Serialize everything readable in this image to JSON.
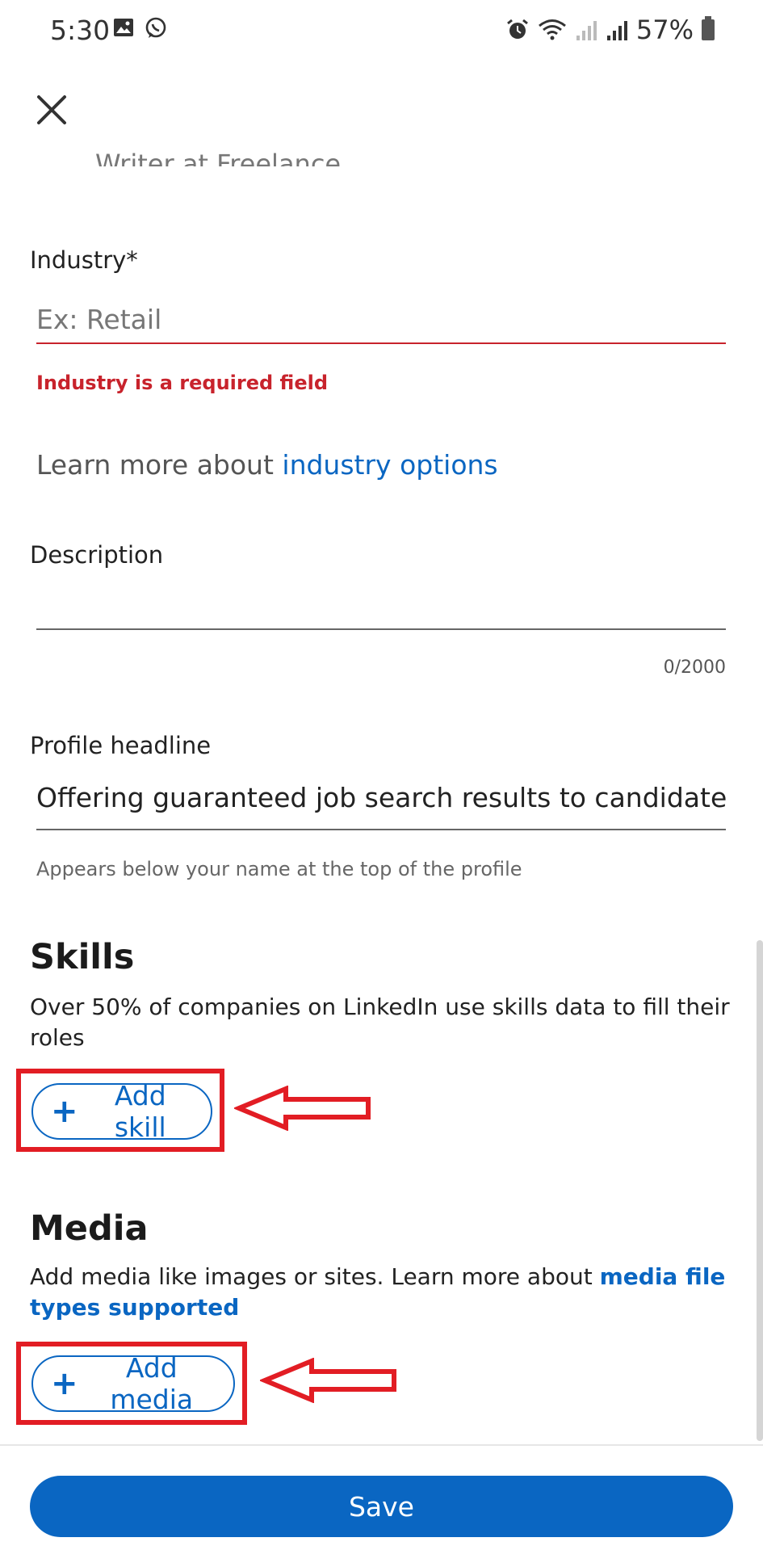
{
  "status_bar": {
    "time": "5:30",
    "battery": "57%",
    "icons": [
      "gallery-icon",
      "whatsapp-icon",
      "alarm-icon",
      "wifi-icon",
      "signal-icon",
      "battery-icon"
    ]
  },
  "header": {
    "close_icon": "close-icon"
  },
  "partial_text": "Writer at Freelance",
  "industry": {
    "label": "Industry*",
    "placeholder": "Ex: Retail",
    "value": "",
    "error": "Industry is a required field"
  },
  "learn_more": {
    "prefix": "Learn more about ",
    "link": "industry options"
  },
  "description": {
    "label": "Description",
    "value": "",
    "counter": "0/2000"
  },
  "profile_headline": {
    "label": "Profile headline",
    "value": "Offering guaranteed job search results to candidate",
    "helper": "Appears below your name at the top of the profile"
  },
  "skills": {
    "title": "Skills",
    "description": "Over 50% of companies on LinkedIn use skills data to fill their roles",
    "add_label": "Add skill"
  },
  "media": {
    "title": "Media",
    "description_prefix": "Add media like images or sites. Learn more about ",
    "description_link": "media file types supported",
    "add_label": "Add media"
  },
  "footer": {
    "save_label": "Save"
  },
  "colors": {
    "accent": "#0a66c2",
    "error": "#c8232c",
    "annotation": "#e21d24"
  }
}
